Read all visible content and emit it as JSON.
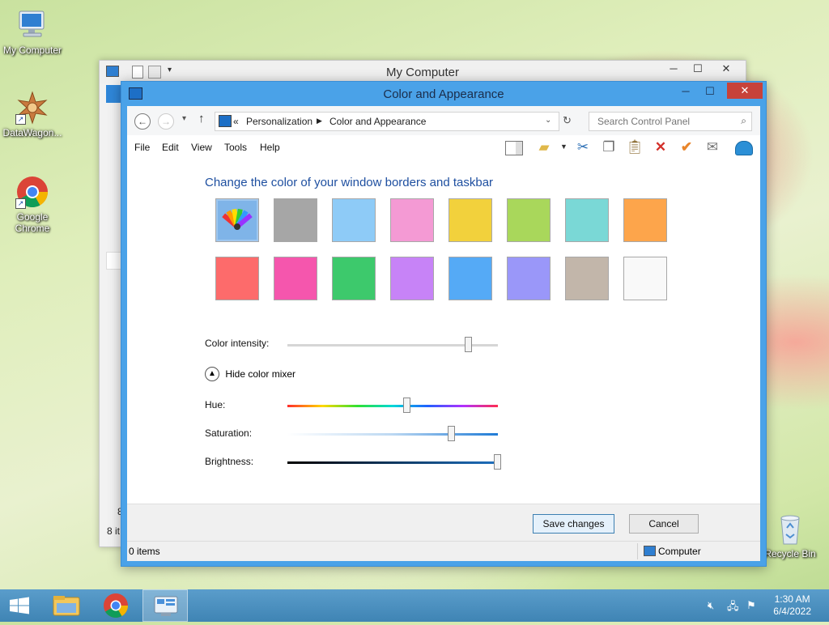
{
  "desktop": {
    "icons": [
      {
        "label": "My Computer"
      },
      {
        "label": "DataWagon..."
      },
      {
        "label": "Google Chrome"
      },
      {
        "label": "Recycle Bin"
      }
    ]
  },
  "back_window": {
    "title": "My Computer",
    "status_count": "8 it",
    "side_digit": "8"
  },
  "window": {
    "title": "Color and Appearance",
    "breadcrumb": {
      "sep": "«",
      "items": [
        "Personalization",
        "Color and Appearance"
      ]
    },
    "search_placeholder": "Search Control Panel",
    "menu": [
      "File",
      "Edit",
      "View",
      "Tools",
      "Help"
    ],
    "heading": "Change the color of your window borders and taskbar",
    "swatches": [
      {
        "color": "#7fb4e8",
        "name": "automatic",
        "selected": true
      },
      {
        "color": "#a6a6a6"
      },
      {
        "color": "#8ecbf7"
      },
      {
        "color": "#f49ad4"
      },
      {
        "color": "#f2d13c"
      },
      {
        "color": "#a9d75b"
      },
      {
        "color": "#7ad8d6"
      },
      {
        "color": "#fda54b"
      },
      {
        "color": "#fd6b6b"
      },
      {
        "color": "#f556ad"
      },
      {
        "color": "#3dc96c"
      },
      {
        "color": "#c783f7"
      },
      {
        "color": "#55aaf6"
      },
      {
        "color": "#9a97f9"
      },
      {
        "color": "#c2b6aa"
      },
      {
        "color": "#f9f9f9"
      }
    ],
    "color_intensity_label": "Color intensity:",
    "color_intensity_value": 0.86,
    "mixer_toggle_label": "Hide color mixer",
    "hue_label": "Hue:",
    "hue_value": 0.57,
    "saturation_label": "Saturation:",
    "saturation_value": 0.78,
    "brightness_label": "Brightness:",
    "brightness_value": 1.0,
    "save_label": "Save changes",
    "cancel_label": "Cancel",
    "status_items": "0 items",
    "status_location": "Computer"
  },
  "taskbar": {
    "apps": [
      "start",
      "file-explorer",
      "google-chrome",
      "control-panel"
    ],
    "time": "1:30 AM",
    "date": "6/4/2022"
  }
}
